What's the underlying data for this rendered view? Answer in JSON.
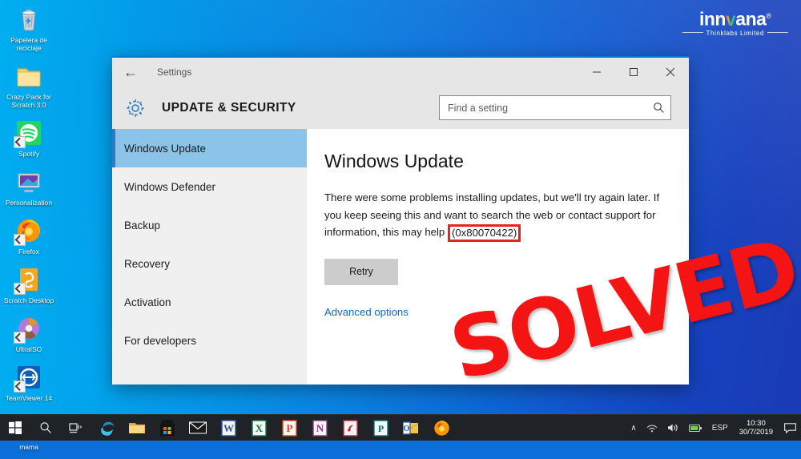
{
  "desktop": {
    "icons": [
      {
        "name": "recycle-bin",
        "label": "Papelera de reciclaje",
        "shortcut": false
      },
      {
        "name": "folder-crazy-pack",
        "label": "Crazy Pack for Scratch 3.0",
        "shortcut": false
      },
      {
        "name": "spotify",
        "label": "Spotify",
        "shortcut": true
      },
      {
        "name": "personalization",
        "label": "Personalization",
        "shortcut": false
      },
      {
        "name": "firefox",
        "label": "Firefox",
        "shortcut": true
      },
      {
        "name": "scratch-desktop",
        "label": "Scratch Desktop",
        "shortcut": true
      },
      {
        "name": "ultraiso",
        "label": "UltraISO",
        "shortcut": true
      },
      {
        "name": "teamviewer",
        "label": "TeamViewer 14",
        "shortcut": true
      },
      {
        "name": "mama-file",
        "label": "mama",
        "shortcut": false
      }
    ]
  },
  "logo": {
    "name_part1": "inn",
    "name_v": "v",
    "name_part2": "ana",
    "registered": "®",
    "tagline": "Thinklabs Limited"
  },
  "window": {
    "titlebar": {
      "back_label": "←",
      "title": "Settings",
      "minimize": "minimize-button",
      "maximize": "maximize-button",
      "close": "close-button"
    },
    "header": {
      "title": "UPDATE & SECURITY",
      "gear_icon": "gear-icon"
    },
    "search": {
      "placeholder": "Find a setting",
      "value": "",
      "icon": "search-icon"
    },
    "sidebar": {
      "items": [
        {
          "label": "Windows Update",
          "selected": true
        },
        {
          "label": "Windows Defender",
          "selected": false
        },
        {
          "label": "Backup",
          "selected": false
        },
        {
          "label": "Recovery",
          "selected": false
        },
        {
          "label": "Activation",
          "selected": false
        },
        {
          "label": "For developers",
          "selected": false
        }
      ]
    },
    "content": {
      "title": "Windows Update",
      "message_before": "There were some problems installing updates, but we'll try again later. If you keep seeing this and want to search the web or contact support for information, this may help",
      "error_code": "(0x80070422)",
      "retry_label": "Retry",
      "advanced_link": "Advanced options"
    }
  },
  "overlay": {
    "stamp_text": "SOLVED",
    "stamp_color": "#f41414"
  },
  "taskbar": {
    "items": [
      {
        "name": "start-button",
        "icon": "windows-logo"
      },
      {
        "name": "search-button",
        "icon": "search-icon"
      },
      {
        "name": "task-view-button",
        "icon": "task-view-icon"
      },
      {
        "name": "edge-button",
        "icon": "edge-icon"
      },
      {
        "name": "file-explorer-button",
        "icon": "folder-icon"
      },
      {
        "name": "microsoft-store-button",
        "icon": "store-icon"
      },
      {
        "name": "mail-button",
        "icon": "envelope-icon"
      },
      {
        "name": "word-button",
        "icon": "word-icon"
      },
      {
        "name": "excel-button",
        "icon": "excel-icon"
      },
      {
        "name": "powerpoint-button",
        "icon": "powerpoint-icon"
      },
      {
        "name": "onenote-button",
        "icon": "onenote-icon"
      },
      {
        "name": "access-button",
        "icon": "access-icon"
      },
      {
        "name": "publisher-button",
        "icon": "publisher-icon"
      },
      {
        "name": "outlook-button",
        "icon": "outlook-icon"
      },
      {
        "name": "firefox-button",
        "icon": "firefox-icon"
      }
    ],
    "tray": {
      "chevron": "∧",
      "network_icon": "network-icon",
      "volume_icon": "volume-icon",
      "battery_icon": "battery-icon",
      "language": "ESP",
      "time": "10:30",
      "date": "30/7/2019",
      "action_center": "action-center-icon"
    }
  },
  "colors": {
    "accent": "#0078d7",
    "selection": "#8cc3e8",
    "link": "#0c69c8",
    "error_border": "#e8241c",
    "taskbar": "#1f2226"
  }
}
